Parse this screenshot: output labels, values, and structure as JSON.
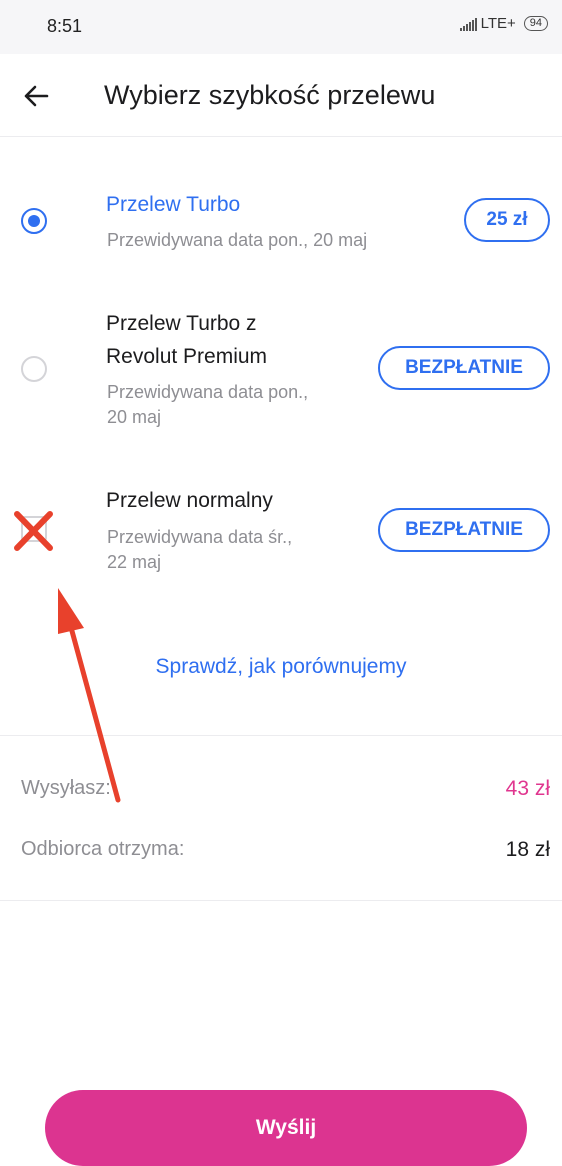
{
  "status_bar": {
    "time": "8:51",
    "network": "LTE+",
    "battery": "94"
  },
  "header": {
    "title": "Wybierz szybkość przelewu",
    "back_icon": "arrow-left-icon"
  },
  "options": [
    {
      "title": "Przelew Turbo",
      "subtitle": "Przewidywana data pon., 20 maj",
      "price": "25 zł",
      "selected": true
    },
    {
      "title_line1": "Przelew Turbo z",
      "title_line2": "Revolut Premium",
      "subtitle_line1": "Przewidywana data pon.,",
      "subtitle_line2": "20 maj",
      "price": "BEZPŁATNIE",
      "selected": false
    },
    {
      "title": "Przelew normalny",
      "subtitle_line1": "Przewidywana data śr.,",
      "subtitle_line2": "22 maj",
      "price": "BEZPŁATNIE",
      "selected": false
    }
  ],
  "compare_link": "Sprawdź, jak porównujemy",
  "summary": {
    "send_label": "Wysyłasz:",
    "send_value": "43 zł",
    "receive_label": "Odbiorca otrzyma:",
    "receive_value": "18 zł"
  },
  "send_button": "Wyślij",
  "colors": {
    "accent_blue": "#2f6ff0",
    "brand_pink": "#dc3490",
    "annotation_red": "#e8412c"
  }
}
